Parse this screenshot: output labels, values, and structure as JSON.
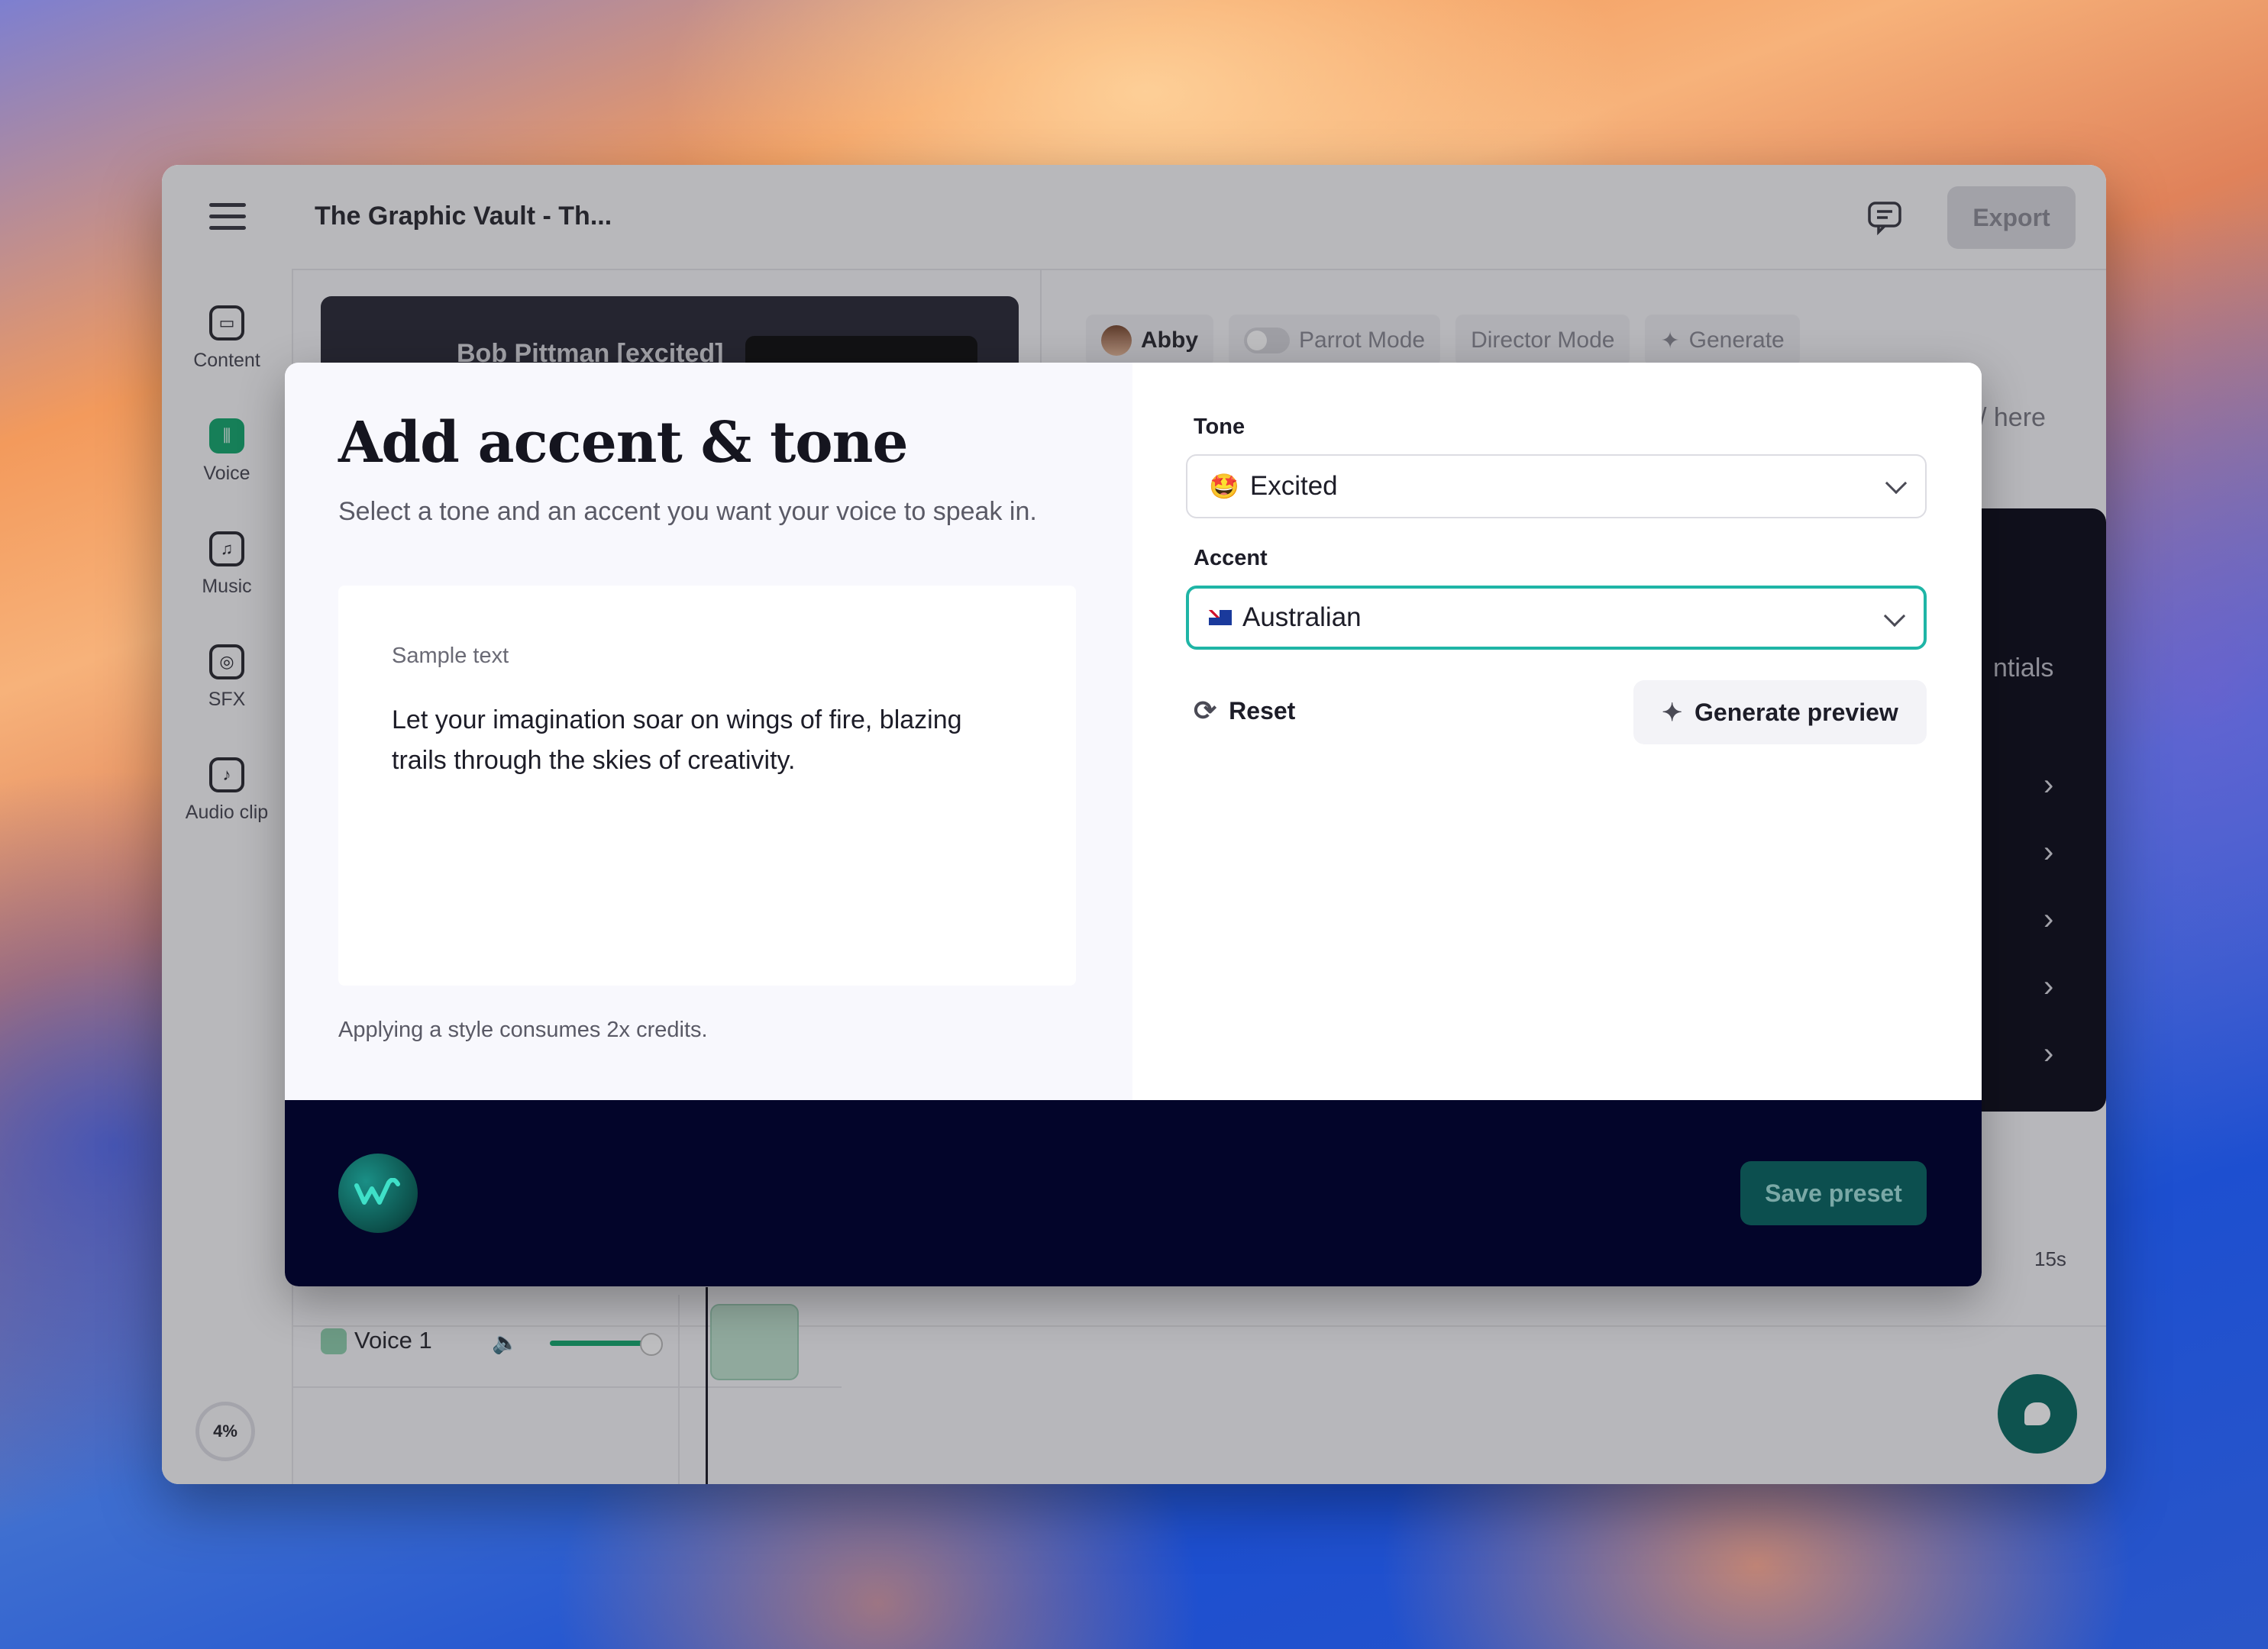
{
  "app": {
    "document_title": "The Graphic Vault - Th...",
    "export_label": "Export"
  },
  "sidebar": {
    "items": [
      {
        "label": "Content",
        "icon": "subtitles-icon"
      },
      {
        "label": "Voice",
        "icon": "waveform-icon"
      },
      {
        "label": "Music",
        "icon": "music-note-icon"
      },
      {
        "label": "SFX",
        "icon": "sfx-icon"
      },
      {
        "label": "Audio clip",
        "icon": "audio-clip-icon"
      }
    ],
    "usage_percent": "4%"
  },
  "background_panel": {
    "speaker_line": "Bob Pittman [excited]",
    "voice_name": "Abby",
    "parrot_mode": "Parrot Mode",
    "director_mode": "Director Mode",
    "generate": "Generate",
    "placeholder_tail": "/ here",
    "panel_text": "ntials",
    "track_name": "Voice 1",
    "tick_15s": "15s"
  },
  "modal": {
    "title": "Add accent & tone",
    "subtitle": "Select a tone and an accent you want your voice to speak in.",
    "sample_label": "Sample text",
    "sample_text": "Let your imagination soar on wings of fire, blazing trails through the skies of creativity.",
    "credits_note": "Applying a style consumes 2x credits.",
    "tone_label": "Tone",
    "tone_value": "Excited",
    "tone_emoji": "🤩",
    "accent_label": "Accent",
    "accent_value": "Australian",
    "reset_label": "Reset",
    "generate_preview_label": "Generate preview",
    "save_preset_label": "Save preset"
  },
  "colors": {
    "accent_teal": "#1fb5a6",
    "footer_navy": "#03052a",
    "voice_green": "#17a86f"
  }
}
